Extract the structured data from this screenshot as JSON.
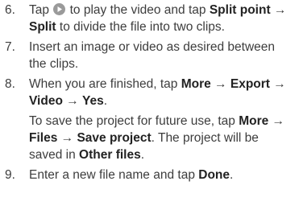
{
  "steps": [
    {
      "num": "6.",
      "t1": "Tap ",
      "icon": "play-icon",
      "t2": " to play the video and tap ",
      "b1": "Split point",
      "t3": " → ",
      "b2": "Split",
      "t4": " to divide the file into two clips."
    },
    {
      "num": "7.",
      "text": "Insert an image or video as desired between the clips."
    },
    {
      "num": "8.",
      "t1": "When you are finished, tap ",
      "b1": "More",
      "t2": " → ",
      "b2": "Export",
      "t3": " → ",
      "b3": "Video",
      "t4": " → ",
      "b4": "Yes",
      "t5": "."
    },
    {
      "num": "9.",
      "t1": "Enter a new file name and tap ",
      "b1": "Done",
      "t2": "."
    }
  ],
  "note": {
    "t1": "To save the project for future use, tap ",
    "b1": "More",
    "t2": " → ",
    "b2": "Files",
    "t3": " → ",
    "b3": "Save project",
    "t4": ". The project will be saved in ",
    "b4": "Other files",
    "t5": "."
  },
  "colors": {
    "text": "#3d3d3d",
    "bold": "#222222",
    "icon": "#9a9a9a"
  }
}
